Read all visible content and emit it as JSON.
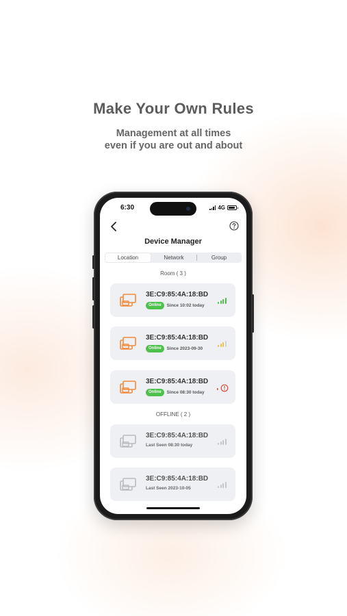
{
  "promo": {
    "title": "Make Your Own Rules",
    "subtitle_line1": "Management at all times",
    "subtitle_line2": "even if you are out and about"
  },
  "status_bar": {
    "time": "6:30",
    "network": "4G"
  },
  "header": {
    "title": "Device Manager",
    "back_icon": "chevron-left-icon",
    "help_icon": "question-circle-icon"
  },
  "tabs": [
    {
      "label": "Location",
      "active": true
    },
    {
      "label": "Network",
      "active": false
    },
    {
      "label": "Group",
      "active": false
    }
  ],
  "sections": {
    "room": "Room ( 3 )",
    "offline": "OFFLINE ( 2 )"
  },
  "devices": [
    {
      "mac": "3E:C9:85:4A:18:BD",
      "status": "Online",
      "since": "Since 10:02 today",
      "signal": "strong",
      "icon": "device-icon"
    },
    {
      "mac": "3E:C9:85:4A:18:BD",
      "status": "Online",
      "since": "Since 2023-09-30",
      "signal": "medium",
      "icon": "device-icon"
    },
    {
      "mac": "3E:C9:85:4A:18:BD",
      "status": "Online",
      "since": "Since 08:30 today",
      "signal": "alert",
      "icon": "device-icon"
    },
    {
      "mac": "3E:C9:85:4A:18:BD",
      "last_seen": "Last Seen 08:30 today",
      "signal": "none",
      "icon": "device-icon"
    },
    {
      "mac": "3E:C9:85:4A:18:BD",
      "last_seen": "Last Seen 2023-10-05",
      "signal": "none",
      "icon": "device-icon"
    }
  ],
  "colors": {
    "accent_orange": "#F08A3C",
    "online_green": "#4CC24C",
    "signal_green": "#4CC24C",
    "signal_yellow": "#E8C548",
    "alert_red": "#E04A3A",
    "offline_gray": "#B8BBC0"
  }
}
